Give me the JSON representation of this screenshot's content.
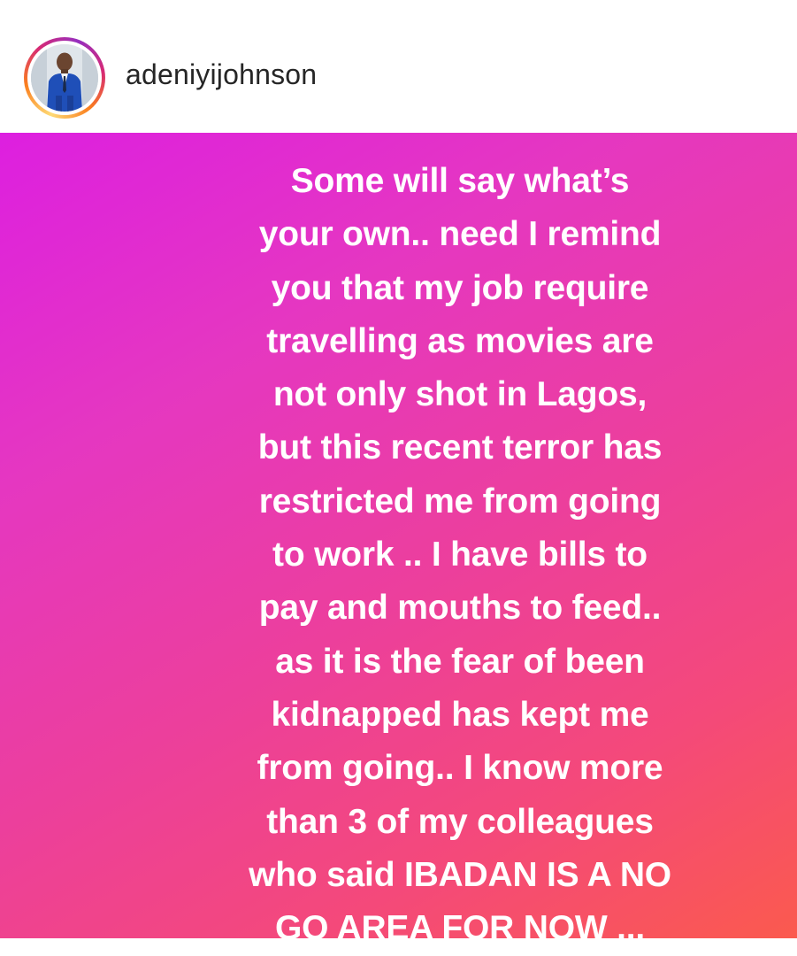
{
  "header": {
    "username": "adeniyijohnson",
    "avatar_icon": "profile-photo-man-in-blue-suit"
  },
  "story": {
    "background_colors": [
      "#dd1fe0",
      "#ec3f9c",
      "#fb5a4e"
    ],
    "text_color": "#ffffff",
    "lines": [
      "Some will say what’s",
      "your own.. need I remind",
      "you that my job require",
      "travelling as movies are",
      "not only shot in Lagos,",
      "but this recent terror has",
      "restricted me from going",
      "to work .. I have bills to",
      "pay and mouths to feed..",
      "as it is the fear of been",
      "kidnapped has kept me",
      "from going.. I know more",
      "than 3 of my colleagues",
      "who said IBADAN IS A NO",
      "GO AREA FOR NOW ..."
    ]
  }
}
